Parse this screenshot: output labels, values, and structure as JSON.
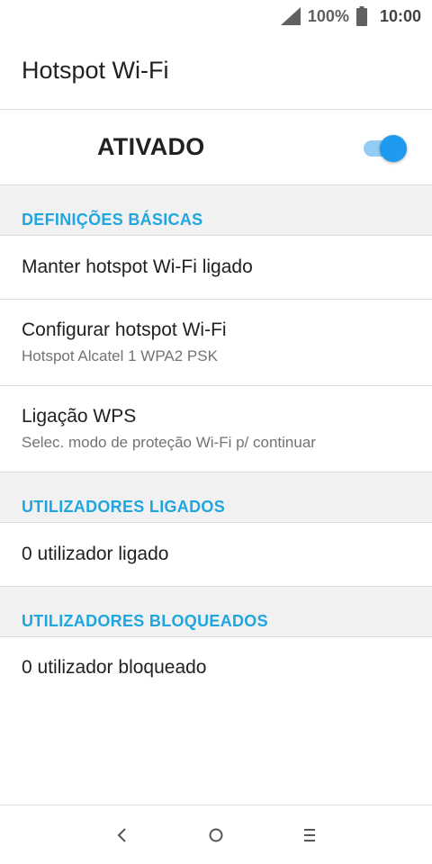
{
  "status_bar": {
    "battery_percent": "100%",
    "time": "10:00",
    "icons": [
      "signal-icon",
      "battery-icon"
    ]
  },
  "app_bar": {
    "title": "Hotspot Wi-Fi"
  },
  "master_switch": {
    "label": "ATIVADO",
    "state": "on",
    "accent_color": "#1e9af0"
  },
  "sections": {
    "basic": {
      "header": "DEFINIÇÕES BÁSICAS",
      "items": [
        {
          "title": "Manter hotspot Wi-Fi ligado"
        },
        {
          "title": "Configurar hotspot Wi-Fi",
          "summary": "Hotspot Alcatel 1 WPA2 PSK"
        },
        {
          "title": "Ligação WPS",
          "summary": "Selec. modo de proteção Wi-Fi p/ continuar"
        }
      ]
    },
    "connected": {
      "header": "UTILIZADORES LIGADOS",
      "items": [
        {
          "title": "0 utilizador ligado"
        }
      ]
    },
    "blocked": {
      "header": "UTILIZADORES BLOQUEADOS",
      "items": [
        {
          "title": "0 utilizador bloqueado"
        }
      ]
    }
  },
  "nav_bar": {
    "icons": [
      "back-icon",
      "home-icon",
      "menu-icon"
    ]
  },
  "colors": {
    "section_header_text": "#1fa6e0",
    "section_header_bg": "#f1f1f1",
    "divider": "#dcdcdc"
  }
}
